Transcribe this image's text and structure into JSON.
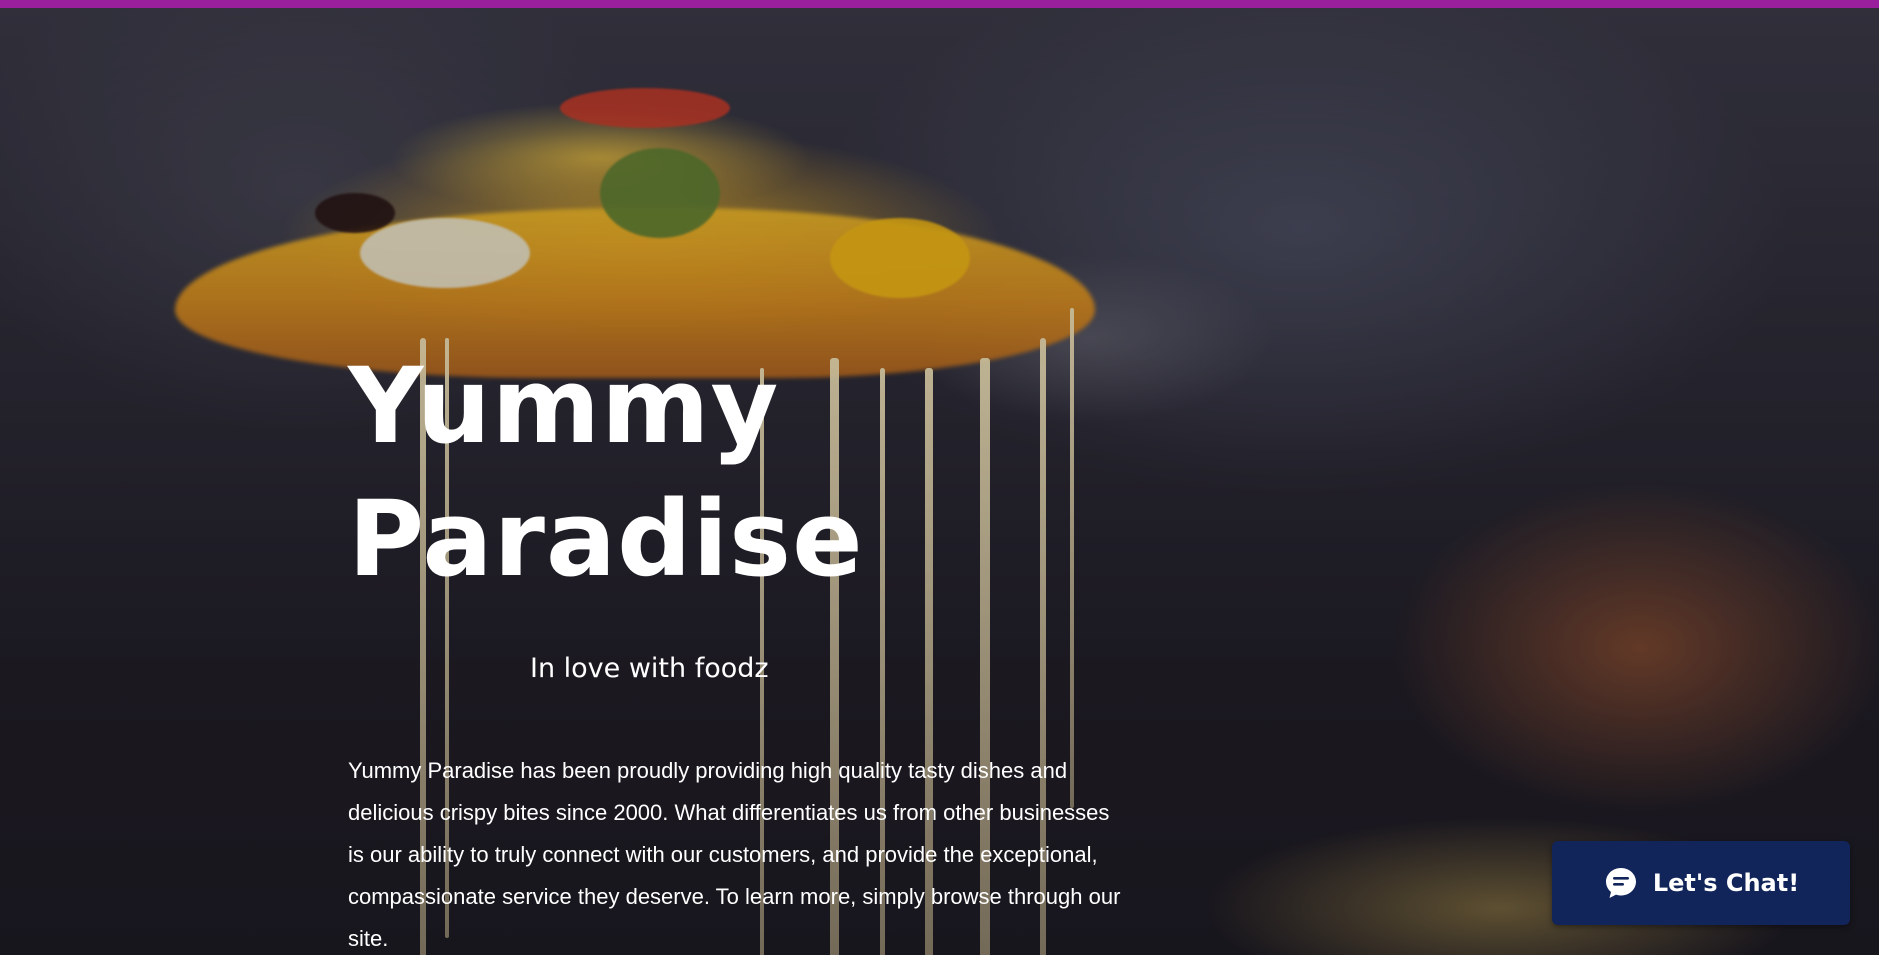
{
  "hero": {
    "title_line1": "Yummy",
    "title_line2": "Paradise",
    "tagline": "In love with foodz",
    "description": "Yummy Paradise has been proudly providing high quality tasty dishes and delicious crispy bites since 2000. What differentiates us from other businesses is our ability to truly connect with our customers, and provide the exceptional, compassionate service they deserve. To learn more, simply browse through our site."
  },
  "chat_widget": {
    "label": "Let's Chat!",
    "icon": "chat-bubble-icon"
  },
  "colors": {
    "top_strip": "#9a1f9c",
    "chat_button": "#12255a",
    "text": "#ffffff"
  }
}
